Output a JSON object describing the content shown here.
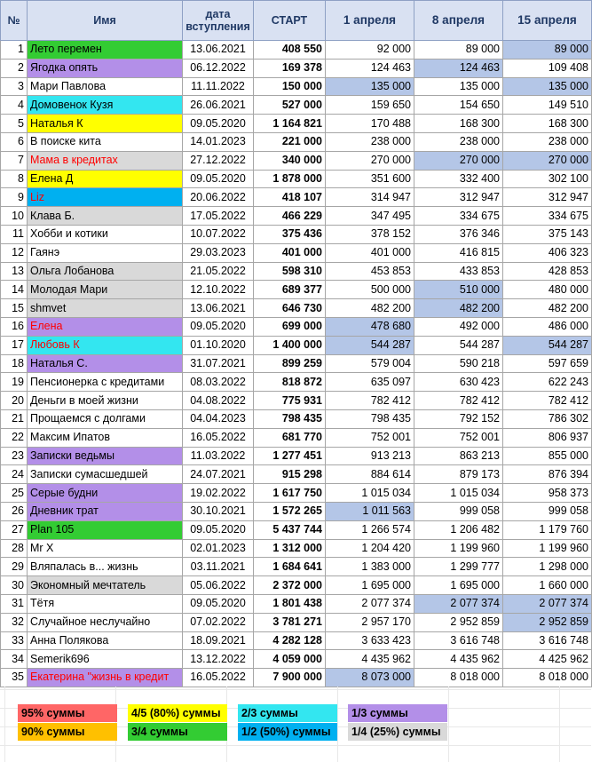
{
  "headers": {
    "num": "№",
    "name": "Имя",
    "date_line1": "дата",
    "date_line2": "вступления",
    "start": "СТАРТ",
    "apr1": "1 апреля",
    "apr8": "8 апреля",
    "apr15": "15 апреля"
  },
  "colors": {
    "green": "#33cc33",
    "purple": "#b38fe8",
    "cyan": "#33e6f0",
    "yellow": "#ffff00",
    "gray": "#d9d9d9",
    "blue": "#00b0f0",
    "lightblue": "#b4c6e7",
    "orange": "#ffc000",
    "red": "#ff6666"
  },
  "rows": [
    {
      "n": "1",
      "name": "Лето перемен",
      "date": "13.06.2021",
      "start": "408 550",
      "a1": "92 000",
      "a8": "89 000",
      "a15": "89 000",
      "bg": "green",
      "hl": [
        false,
        false,
        true
      ]
    },
    {
      "n": "2",
      "name": "Ягодка опять",
      "date": "06.12.2022",
      "start": "169 378",
      "a1": "124 463",
      "a8": "124 463",
      "a15": "109 408",
      "bg": "purple",
      "hl": [
        false,
        true,
        false
      ]
    },
    {
      "n": "3",
      "name": "Мари Павлова",
      "date": "11.11.2022",
      "start": "150 000",
      "a1": "135 000",
      "a8": "135 000",
      "a15": "135 000",
      "bg": "",
      "hl": [
        true,
        false,
        true
      ]
    },
    {
      "n": "4",
      "name": "Домовенок Кузя",
      "date": "26.06.2021",
      "start": "527 000",
      "a1": "159 650",
      "a8": "154 650",
      "a15": "149 510",
      "bg": "cyan",
      "hl": [
        false,
        false,
        false
      ]
    },
    {
      "n": "5",
      "name": "Наталья К",
      "date": "09.05.2020",
      "start": "1 164 821",
      "a1": "170 488",
      "a8": "168 300",
      "a15": "168 300",
      "bg": "yellow",
      "hl": [
        false,
        false,
        false
      ]
    },
    {
      "n": "6",
      "name": "В поиске кита",
      "date": "14.01.2023",
      "start": "221 000",
      "a1": "238 000",
      "a8": "238 000",
      "a15": "238 000",
      "bg": "",
      "hl": [
        false,
        false,
        false
      ]
    },
    {
      "n": "7",
      "name": "Мама в кредитах",
      "date": "27.12.2022",
      "start": "340 000",
      "a1": "270 000",
      "a8": "270 000",
      "a15": "270 000",
      "bg": "gray",
      "red": true,
      "hl": [
        false,
        true,
        true
      ]
    },
    {
      "n": "8",
      "name": "Елена Д",
      "date": "09.05.2020",
      "start": "1 878 000",
      "a1": "351 600",
      "a8": "332 400",
      "a15": "302 100",
      "bg": "yellow",
      "hl": [
        false,
        false,
        false
      ]
    },
    {
      "n": "9",
      "name": "Liz",
      "date": "20.06.2022",
      "start": "418 107",
      "a1": "314 947",
      "a8": "312 947",
      "a15": "312 947",
      "bg": "blue",
      "red": true,
      "hl": [
        false,
        false,
        false
      ]
    },
    {
      "n": "10",
      "name": "Клава Б.",
      "date": "17.05.2022",
      "start": "466 229",
      "a1": "347 495",
      "a8": "334 675",
      "a15": "334 675",
      "bg": "gray",
      "hl": [
        false,
        false,
        false
      ]
    },
    {
      "n": "11",
      "name": "Хобби и котики",
      "date": "10.07.2022",
      "start": "375 436",
      "a1": "378 152",
      "a8": "376 346",
      "a15": "375 143",
      "bg": "",
      "hl": [
        false,
        false,
        false
      ]
    },
    {
      "n": "12",
      "name": "Гаянэ",
      "date": "29.03.2023",
      "start": "401 000",
      "a1": "401 000",
      "a8": "416 815",
      "a15": "406 323",
      "bg": "",
      "hl": [
        false,
        false,
        false
      ]
    },
    {
      "n": "13",
      "name": "Ольга Лобанова",
      "date": "21.05.2022",
      "start": "598 310",
      "a1": "453 853",
      "a8": "433 853",
      "a15": "428 853",
      "bg": "gray",
      "hl": [
        false,
        false,
        false
      ]
    },
    {
      "n": "14",
      "name": "Молодая Мари",
      "date": "12.10.2022",
      "start": "689 377",
      "a1": "500 000",
      "a8": "510 000",
      "a15": "480 000",
      "bg": "gray",
      "hl": [
        false,
        true,
        false
      ]
    },
    {
      "n": "15",
      "name": "shmvet",
      "date": "13.06.2021",
      "start": "646 730",
      "a1": "482 200",
      "a8": "482 200",
      "a15": "482 200",
      "bg": "gray",
      "hl": [
        false,
        true,
        false
      ]
    },
    {
      "n": "16",
      "name": "Елена",
      "date": "09.05.2020",
      "start": "699 000",
      "a1": "478 680",
      "a8": "492 000",
      "a15": "486 000",
      "bg": "purple",
      "red": true,
      "hl": [
        true,
        false,
        false
      ]
    },
    {
      "n": "17",
      "name": "Любовь К",
      "date": "01.10.2020",
      "start": "1 400 000",
      "a1": "544 287",
      "a8": "544 287",
      "a15": "544 287",
      "bg": "cyan",
      "red": true,
      "hl": [
        true,
        false,
        true
      ]
    },
    {
      "n": "18",
      "name": "Наталья С.",
      "date": "31.07.2021",
      "start": "899 259",
      "a1": "579 004",
      "a8": "590 218",
      "a15": "597 659",
      "bg": "purple",
      "hl": [
        false,
        false,
        false
      ]
    },
    {
      "n": "19",
      "name": "Пенсионерка с кредитами",
      "date": "08.03.2022",
      "start": "818 872",
      "a1": "635 097",
      "a8": "630 423",
      "a15": "622 243",
      "bg": "",
      "hl": [
        false,
        false,
        false
      ]
    },
    {
      "n": "20",
      "name": "Деньги в моей жизни",
      "date": "04.08.2022",
      "start": "775 931",
      "a1": "782 412",
      "a8": "782 412",
      "a15": "782 412",
      "bg": "",
      "hl": [
        false,
        false,
        false
      ]
    },
    {
      "n": "21",
      "name": "Прощаемся с долгами",
      "date": "04.04.2023",
      "start": "798 435",
      "a1": "798 435",
      "a8": "792 152",
      "a15": "786 302",
      "bg": "",
      "hl": [
        false,
        false,
        false
      ]
    },
    {
      "n": "22",
      "name": "Максим Ипатов",
      "date": "16.05.2022",
      "start": "681 770",
      "a1": "752 001",
      "a8": "752 001",
      "a15": "806 937",
      "bg": "",
      "hl": [
        false,
        false,
        false
      ]
    },
    {
      "n": "23",
      "name": "Записки ведьмы",
      "date": "11.03.2022",
      "start": "1 277 451",
      "a1": "913 213",
      "a8": "863 213",
      "a15": "855 000",
      "bg": "purple",
      "hl": [
        false,
        false,
        false
      ]
    },
    {
      "n": "24",
      "name": "Записки сумасшедшей",
      "date": "24.07.2021",
      "start": "915 298",
      "a1": "884 614",
      "a8": "879 173",
      "a15": "876 394",
      "bg": "",
      "hl": [
        false,
        false,
        false
      ]
    },
    {
      "n": "25",
      "name": "Серые будни",
      "date": "19.02.2022",
      "start": "1 617 750",
      "a1": "1 015 034",
      "a8": "1 015 034",
      "a15": "958 373",
      "bg": "purple",
      "hl": [
        false,
        false,
        false
      ]
    },
    {
      "n": "26",
      "name": "Дневник трат",
      "date": "30.10.2021",
      "start": "1 572 265",
      "a1": "1 011 563",
      "a8": "999 058",
      "a15": "999 058",
      "bg": "purple",
      "hl": [
        true,
        false,
        false
      ]
    },
    {
      "n": "27",
      "name": "Plan 105",
      "date": "09.05.2020",
      "start": "5 437 744",
      "a1": "1 266 574",
      "a8": "1 206 482",
      "a15": "1 179 760",
      "bg": "green",
      "hl": [
        false,
        false,
        false
      ]
    },
    {
      "n": "28",
      "name": "Mr X",
      "date": "02.01.2023",
      "start": "1 312 000",
      "a1": "1 204 420",
      "a8": "1 199 960",
      "a15": "1 199 960",
      "bg": "",
      "hl": [
        false,
        false,
        false
      ]
    },
    {
      "n": "29",
      "name": "Вляпалась в... жизнь",
      "date": "03.11.2021",
      "start": "1 684 641",
      "a1": "1 383 000",
      "a8": "1 299 777",
      "a15": "1 298 000",
      "bg": "",
      "hl": [
        false,
        false,
        false
      ]
    },
    {
      "n": "30",
      "name": "Экономный мечтатель",
      "date": "05.06.2022",
      "start": "2 372 000",
      "a1": "1 695 000",
      "a8": "1 695 000",
      "a15": "1 660 000",
      "bg": "gray",
      "hl": [
        false,
        false,
        false
      ]
    },
    {
      "n": "31",
      "name": "Тётя",
      "date": "09.05.2020",
      "start": "1 801 438",
      "a1": "2 077 374",
      "a8": "2 077 374",
      "a15": "2 077 374",
      "bg": "",
      "hl": [
        false,
        true,
        true
      ]
    },
    {
      "n": "32",
      "name": "Случайное неслучайно",
      "date": "07.02.2022",
      "start": "3 781 271",
      "a1": "2 957 170",
      "a8": "2 952 859",
      "a15": "2 952 859",
      "bg": "",
      "hl": [
        false,
        false,
        true
      ]
    },
    {
      "n": "33",
      "name": "Анна Полякова",
      "date": "18.09.2021",
      "start": "4 282 128",
      "a1": "3 633 423",
      "a8": "3 616 748",
      "a15": "3 616 748",
      "bg": "",
      "hl": [
        false,
        false,
        false
      ]
    },
    {
      "n": "34",
      "name": "Semerik696",
      "date": "13.12.2022",
      "start": "4 059 000",
      "a1": "4 435 962",
      "a8": "4 435 962",
      "a15": "4 425 962",
      "bg": "",
      "hl": [
        false,
        false,
        false
      ]
    },
    {
      "n": "35",
      "name": "Екатерина \"жизнь в кредит",
      "date": "16.05.2022",
      "start": "7 900 000",
      "a1": "8 073 000",
      "a8": "8 018 000",
      "a15": "8 018 000",
      "bg": "purple",
      "red": true,
      "hl": [
        true,
        false,
        false
      ]
    }
  ],
  "legend": [
    {
      "label": "95% суммы",
      "bg": "red"
    },
    {
      "label": "4/5 (80%) суммы",
      "bg": "yellow"
    },
    {
      "label": "2/3 суммы",
      "bg": "cyan"
    },
    {
      "label": "1/3 суммы",
      "bg": "purple"
    },
    {
      "label": "90% суммы",
      "bg": "orange"
    },
    {
      "label": "3/4 суммы",
      "bg": "green"
    },
    {
      "label": "1/2 (50%) суммы",
      "bg": "blue"
    },
    {
      "label": "1/4 (25%) суммы",
      "bg": "gray"
    }
  ]
}
